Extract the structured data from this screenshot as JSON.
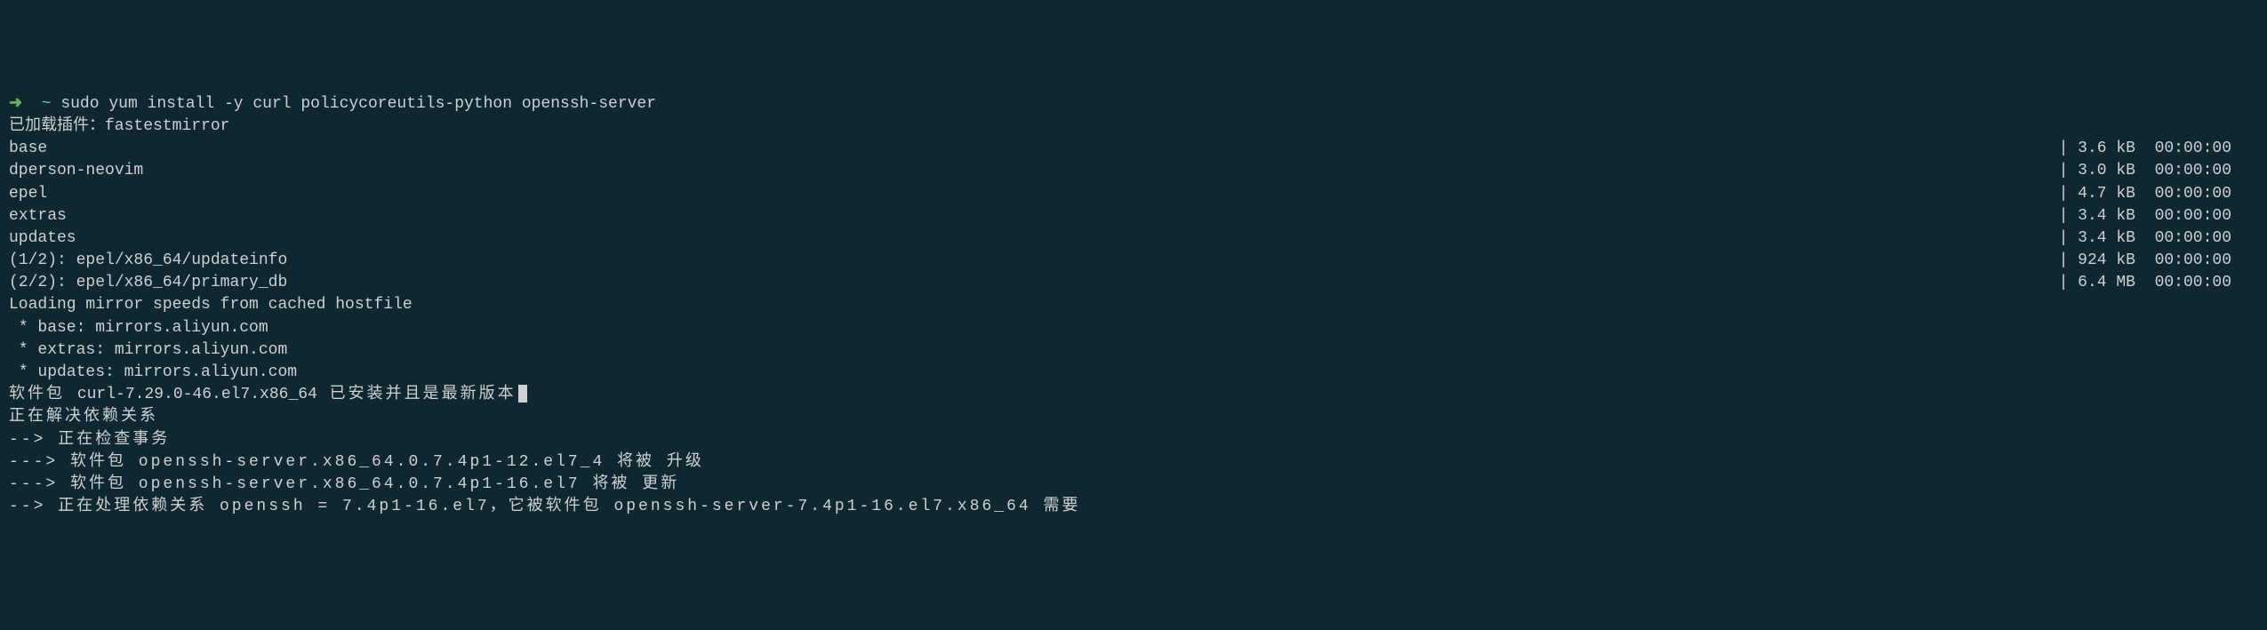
{
  "prompt": {
    "arrow": "➜",
    "tilde": "~",
    "command": "sudo yum install -y curl policycoreutils-python openssh-server"
  },
  "lines": {
    "plugin": "已加载插件：fastestmirror",
    "repos": [
      {
        "name": "base",
        "size": "| 3.6 kB  00:00:00"
      },
      {
        "name": "dperson-neovim",
        "size": "| 3.0 kB  00:00:00"
      },
      {
        "name": "epel",
        "size": "| 4.7 kB  00:00:00"
      },
      {
        "name": "extras",
        "size": "| 3.4 kB  00:00:00"
      },
      {
        "name": "updates",
        "size": "| 3.4 kB  00:00:00"
      },
      {
        "name": "(1/2): epel/x86_64/updateinfo",
        "size": "| 924 kB  00:00:00"
      },
      {
        "name": "(2/2): epel/x86_64/primary_db",
        "size": "| 6.4 MB  00:00:00"
      }
    ],
    "loading": "Loading mirror speeds from cached hostfile",
    "mirrors": [
      " * base: mirrors.aliyun.com",
      " * extras: mirrors.aliyun.com",
      " * updates: mirrors.aliyun.com"
    ],
    "pkg_prefix": "软件包 ",
    "pkg_name": "curl-7.29.0-46.el7.x86_64",
    "pkg_suffix": " 已安装并且是最新版本",
    "resolving": "正在解决依赖关系",
    "checking": "--> 正在检查事务",
    "dep1": "---> 软件包 openssh-server.x86_64.0.7.4p1-12.el7_4 将被 升级",
    "dep2": "---> 软件包 openssh-server.x86_64.0.7.4p1-16.el7 将被 更新",
    "dep3": "--> 正在处理依赖关系 openssh = 7.4p1-16.el7，它被软件包 openssh-server-7.4p1-16.el7.x86_64 需要"
  }
}
